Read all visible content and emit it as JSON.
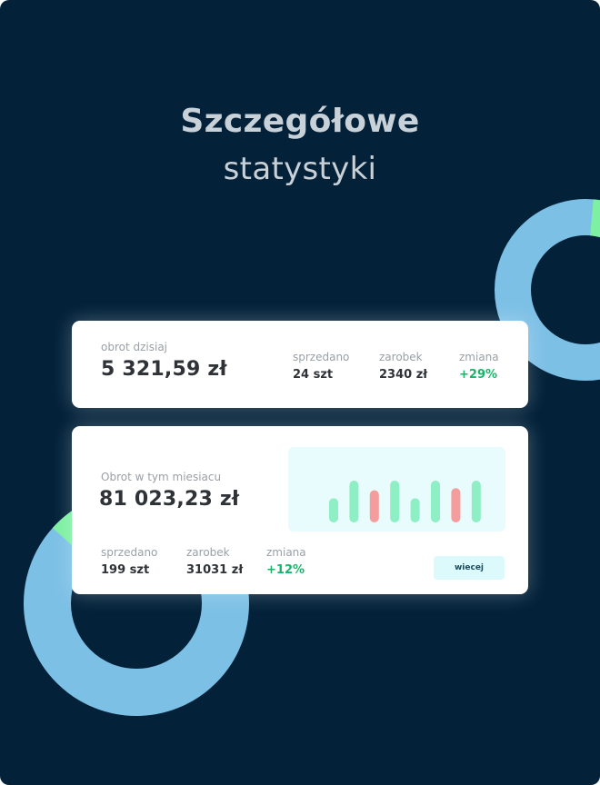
{
  "headline": {
    "line1": "Szczegółowe",
    "line2": "statystyki"
  },
  "today_card": {
    "turnover_label": "obrot dzisiaj",
    "turnover_value": "5 321,59 zł",
    "sold_label": "sprzedano",
    "sold_value": "24 szt",
    "earnings_label": "zarobek",
    "earnings_value": "2340 zł",
    "change_label": "zmiana",
    "change_value": "+29%"
  },
  "month_card": {
    "turnover_label": "Obrot w tym miesiacu",
    "turnover_value": "81 023,23 zł",
    "sold_label": "sprzedano",
    "sold_value": "199 szt",
    "earnings_label": "zarobek",
    "earnings_value": "31031 zł",
    "change_label": "zmiana",
    "change_value": "+12%",
    "more_label": "wiecej"
  },
  "chart_data": {
    "type": "bar",
    "categories": [
      "",
      "",
      "",
      "",
      "",
      "",
      "",
      ""
    ],
    "values": [
      0.58,
      1.0,
      0.77,
      1.0,
      0.58,
      1.0,
      0.82,
      1.0
    ],
    "colors": [
      "#8eeec4",
      "#8eeec4",
      "#f59c9c",
      "#8eeec4",
      "#8eeec4",
      "#8eeec4",
      "#f59c9c",
      "#8eeec4"
    ],
    "title": "",
    "xlabel": "",
    "ylabel": "",
    "ylim": [
      0,
      1
    ]
  },
  "donuts": {
    "colors": {
      "main": "#7dc0e6",
      "accent": "#7ef0a2"
    },
    "top_accent_share": 0.11,
    "bottom_accent_share": 0.06
  },
  "colors": {
    "background": "#03223a",
    "card": "#ffffff",
    "positive": "#19b46a",
    "chart_bg": "#e8fcfd",
    "button_bg": "#dcf9fc"
  }
}
